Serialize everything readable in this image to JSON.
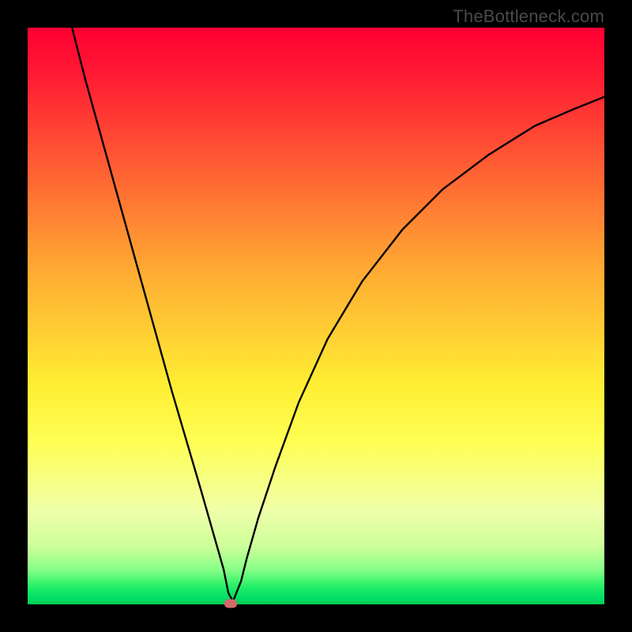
{
  "watermark": "TheBottleneck.com",
  "chart_data": {
    "type": "line",
    "title": "",
    "xlabel": "",
    "ylabel": "",
    "xlim": [
      0,
      100
    ],
    "ylim": [
      0,
      100
    ],
    "series": [
      {
        "name": "curve",
        "x": [
          7.7,
          10,
          15,
          20,
          25,
          30,
          32,
          34,
          34.8,
          35.6,
          37,
          38,
          40,
          43,
          47,
          52,
          58,
          65,
          72,
          80,
          88,
          95,
          100
        ],
        "y": [
          100,
          91,
          73,
          55,
          37,
          20,
          13,
          6,
          2,
          0.5,
          4,
          8,
          15,
          24,
          35,
          46,
          56,
          65,
          72,
          78,
          83,
          86,
          88
        ]
      }
    ],
    "marker": {
      "x": 35.2,
      "y": 0.2,
      "color": "#d46a6a"
    },
    "background_gradient": {
      "type": "vertical",
      "stops": [
        {
          "pos": 0.0,
          "color": "#ff0033"
        },
        {
          "pos": 0.3,
          "color": "#ff7733"
        },
        {
          "pos": 0.62,
          "color": "#ffee33"
        },
        {
          "pos": 0.94,
          "color": "#88ff88"
        },
        {
          "pos": 1.0,
          "color": "#00cc55"
        }
      ]
    }
  }
}
